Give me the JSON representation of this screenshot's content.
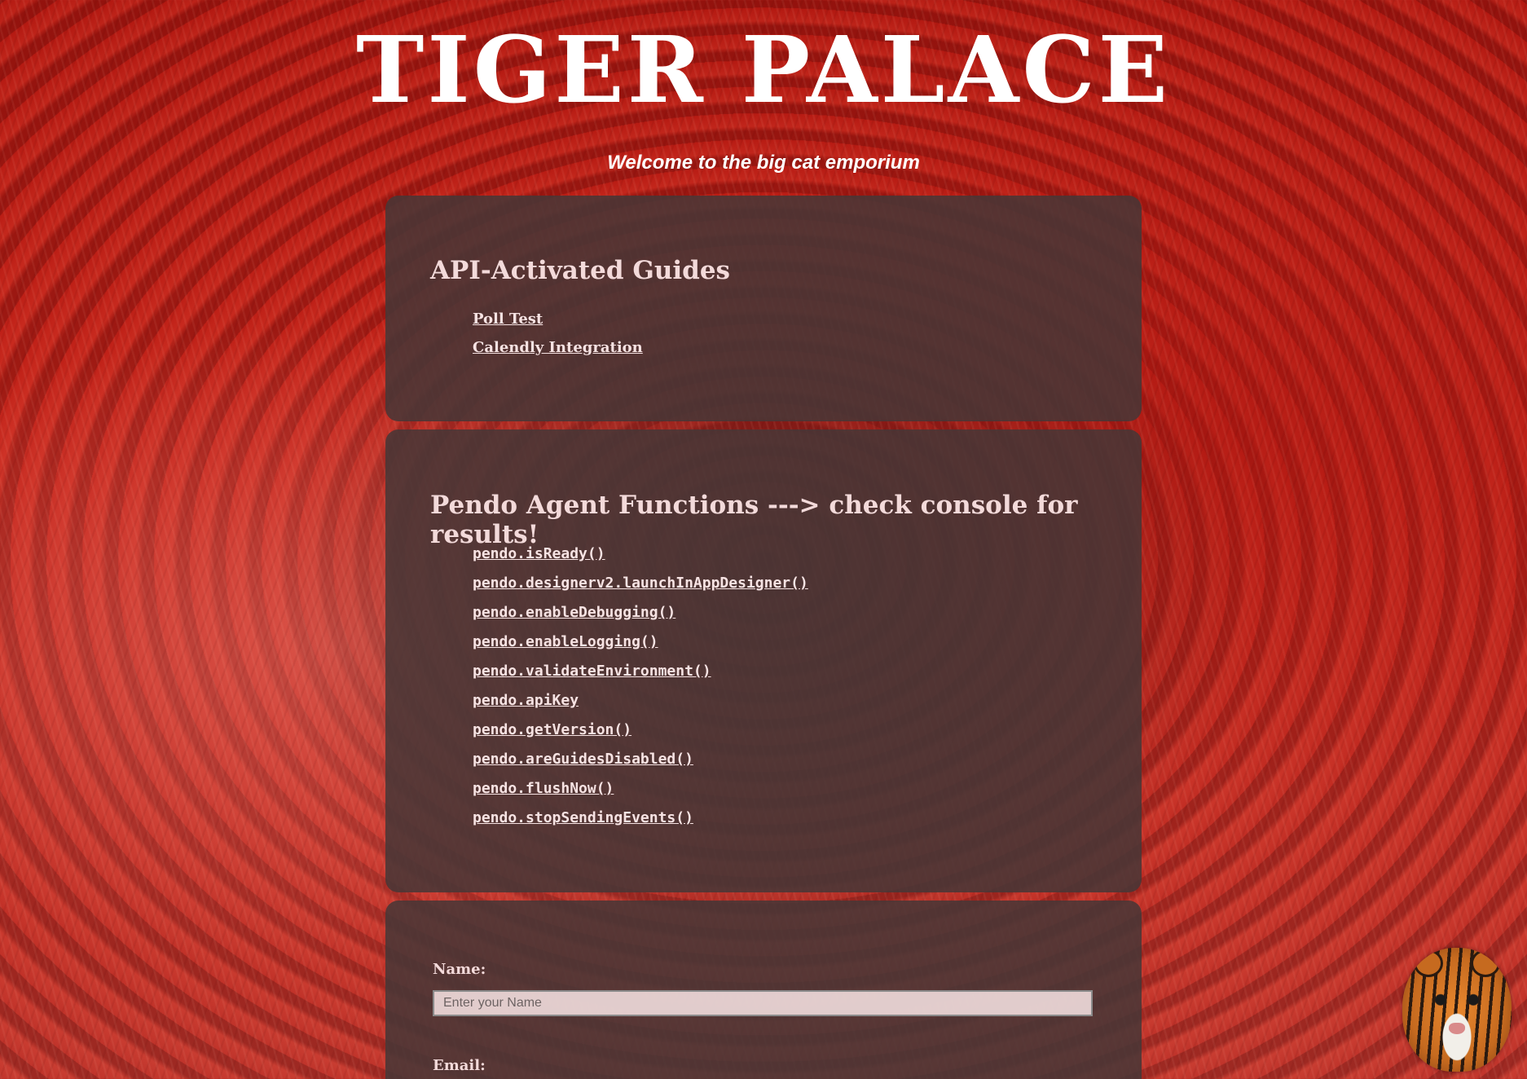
{
  "header": {
    "title": "TIGER PALACE",
    "tagline": "Welcome to the big cat emporium"
  },
  "guides": {
    "heading": "API-Activated Guides",
    "links": [
      "Poll Test",
      "Calendly Integration"
    ]
  },
  "agent_functions": {
    "heading": "Pendo Agent Functions ---> check console for results!",
    "links": [
      "pendo.isReady()",
      "pendo.designerv2.launchInAppDesigner()",
      "pendo.enableDebugging()",
      "pendo.enableLogging()",
      "pendo.validateEnvironment()",
      "pendo.apiKey",
      "pendo.getVersion()",
      "pendo.areGuidesDisabled()",
      "pendo.flushNow()",
      "pendo.stopSendingEvents()"
    ]
  },
  "form": {
    "name_label": "Name:",
    "name_placeholder": "Enter your Name",
    "name_value": "",
    "email_label": "Email:"
  },
  "colors": {
    "background": "#c8251a",
    "panel": "#463737",
    "text": "#f3dada"
  }
}
